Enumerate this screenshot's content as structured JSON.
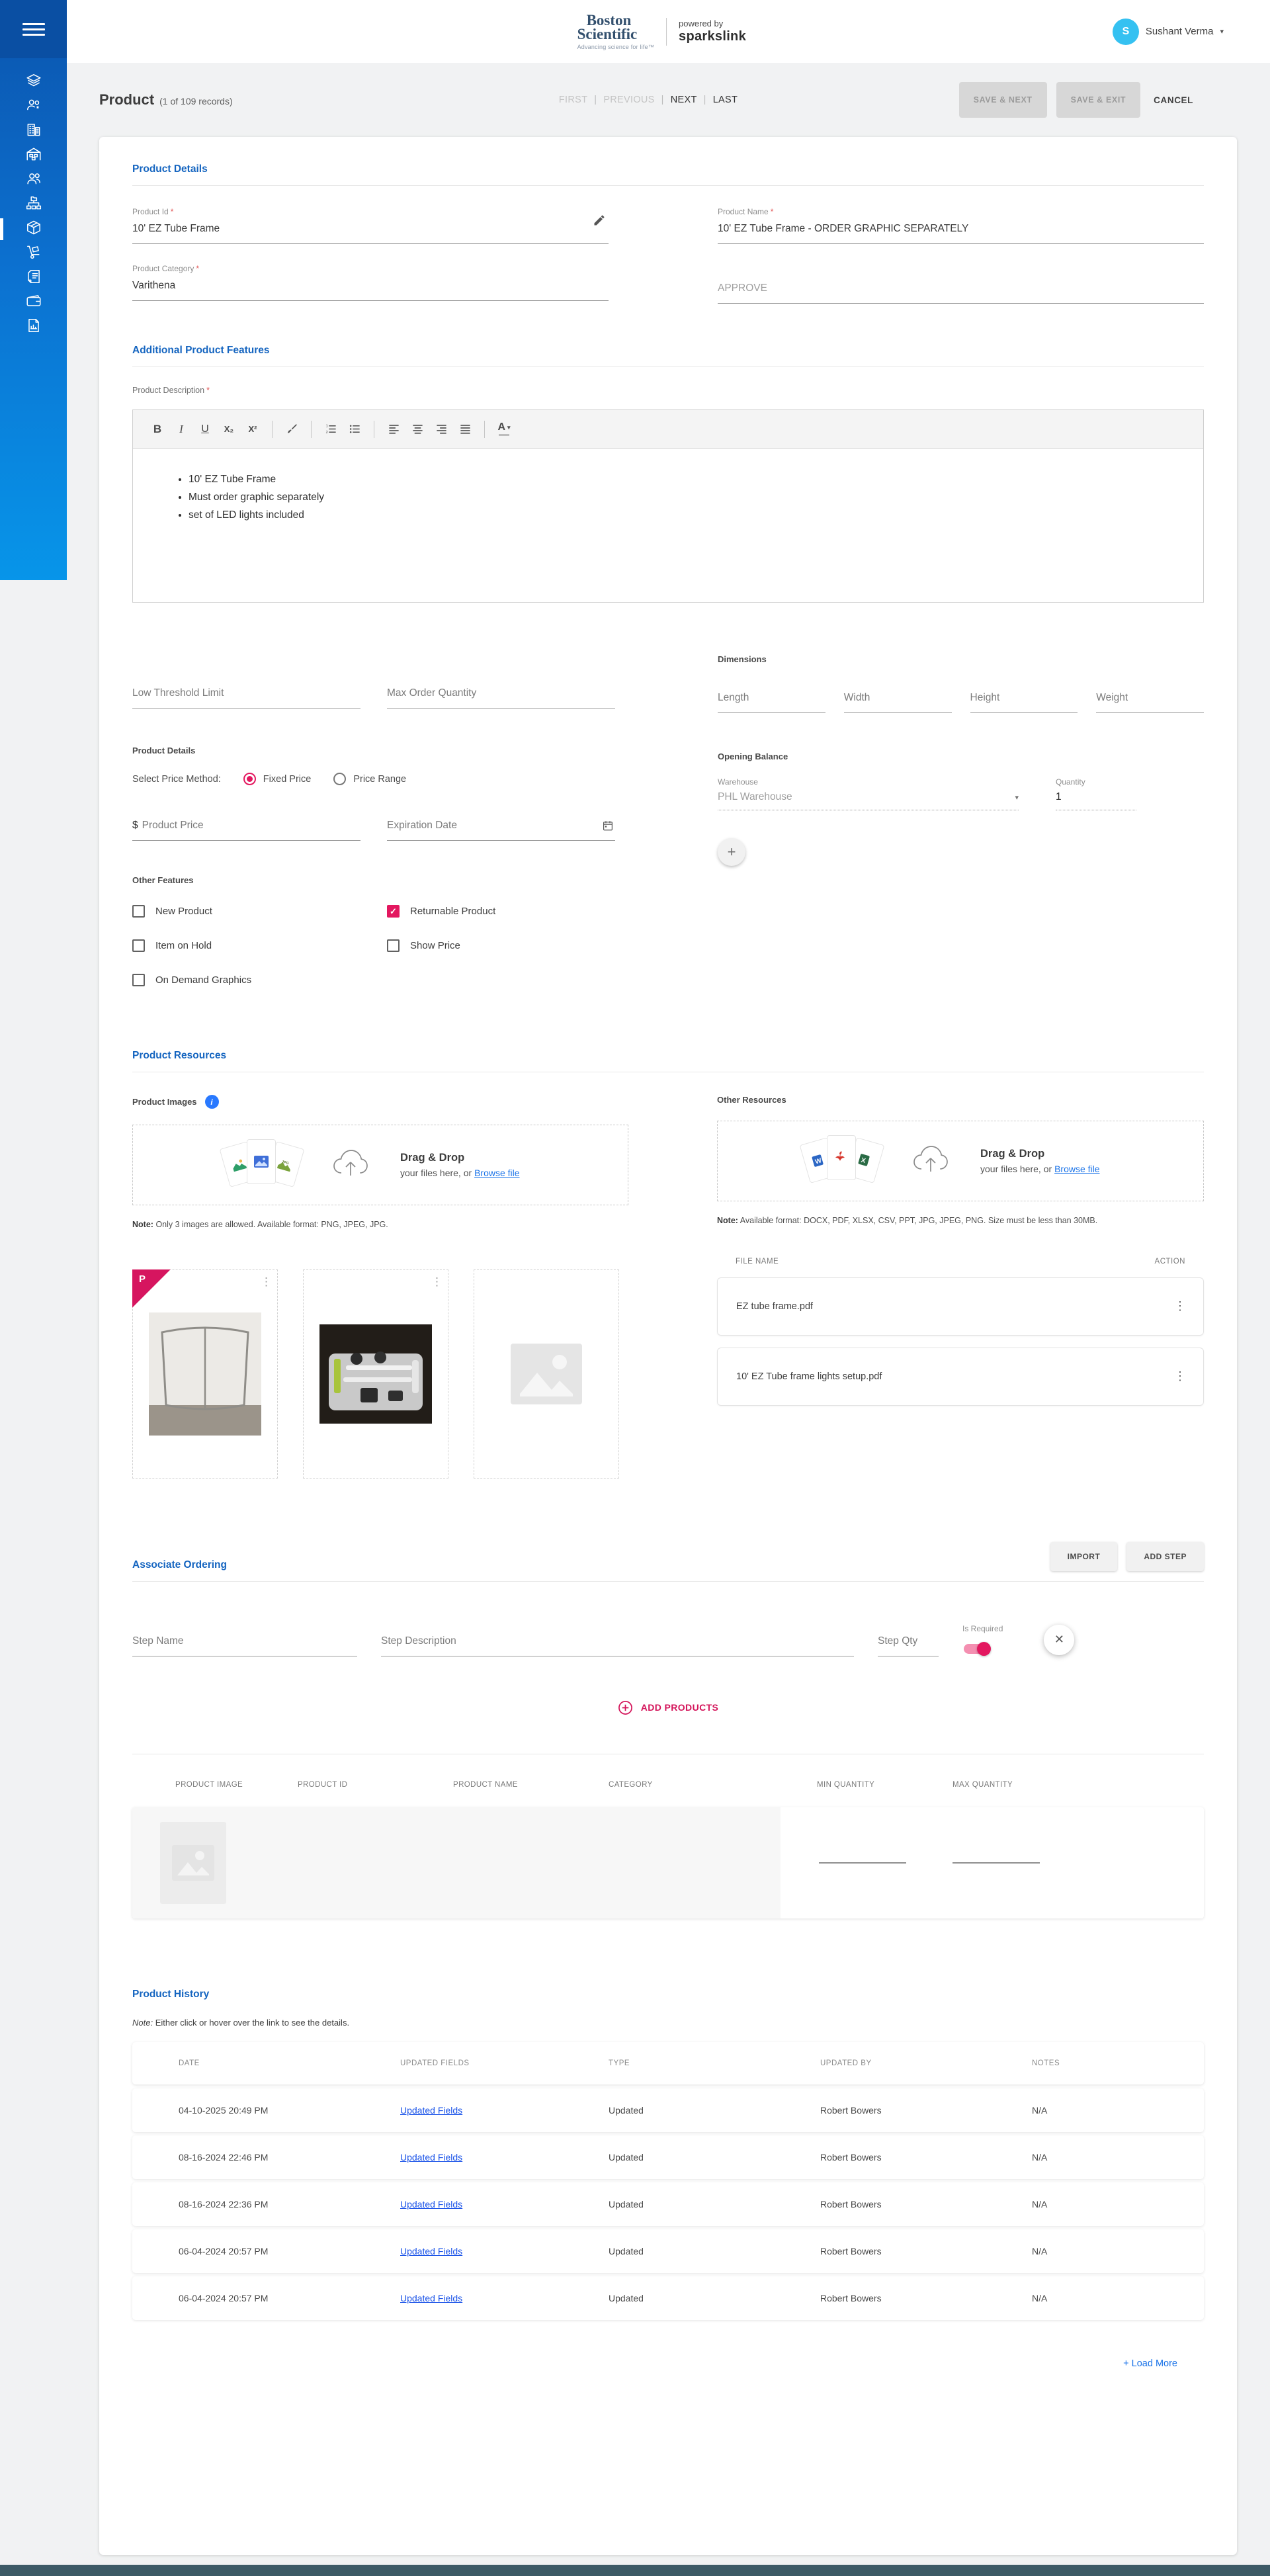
{
  "colors": {
    "accent_pink": "#e3175f",
    "primary_blue": "#1565c0",
    "link_blue": "#1a73e8",
    "sidebar_blue_top": "#0b55ae",
    "sidebar_blue_bottom": "#0795e9",
    "avatar_blue": "#35c1f1",
    "footer_slate": "#3d5a66"
  },
  "icons": {
    "check": "✓",
    "chevron_down": "▾",
    "kebab": "⋮",
    "plus": "+",
    "close": "✕",
    "info": "i",
    "dollar": "$"
  },
  "ui": {
    "required_mark": "*"
  },
  "sidebar": {
    "items": [
      {
        "icon": "layers",
        "active": false
      },
      {
        "icon": "user-roles",
        "active": false
      },
      {
        "icon": "organization",
        "active": false
      },
      {
        "icon": "warehouse",
        "active": false
      },
      {
        "icon": "users",
        "active": false
      },
      {
        "icon": "hierarchy",
        "active": false
      },
      {
        "icon": "products",
        "active": true
      },
      {
        "icon": "orders",
        "active": false
      },
      {
        "icon": "invoices",
        "active": false
      },
      {
        "icon": "wallet",
        "active": false
      },
      {
        "icon": "reports",
        "active": false
      }
    ]
  },
  "header": {
    "logo_line1": "Boston",
    "logo_line2": "Scientific",
    "logo_tagline": "Advancing science for life™",
    "powered_by": "powered by",
    "brand": "sparkslink",
    "user": {
      "initial": "S",
      "name": "Sushant Verma"
    }
  },
  "titlebar": {
    "title": "Product",
    "record_info": "(1 of 109 records)",
    "nav": [
      {
        "label": "FIRST",
        "enabled": false
      },
      {
        "label": "PREVIOUS",
        "enabled": false
      },
      {
        "label": "NEXT",
        "enabled": true
      },
      {
        "label": "LAST",
        "enabled": true
      }
    ],
    "save_next": "SAVE & NEXT",
    "save_exit": "SAVE & EXIT",
    "cancel": "CANCEL"
  },
  "product_details": {
    "heading": "Product Details",
    "product_id": {
      "label": "Product Id",
      "value": "10' EZ Tube Frame"
    },
    "product_name": {
      "label": "Product Name",
      "value": "10' EZ Tube Frame - ORDER GRAPHIC SEPARATELY"
    },
    "product_category": {
      "label": "Product Category",
      "value": "Varithena"
    },
    "approve": {
      "value": "APPROVE"
    }
  },
  "additional_features": {
    "heading": "Additional Product Features",
    "description_label": "Product Description",
    "toolbar": {
      "bold": "B",
      "italic": "I",
      "underline": "U",
      "subscript": "X₂",
      "superscript": "X²",
      "color": "A"
    },
    "bullets": [
      "10' EZ Tube Frame",
      "Must order graphic separately",
      "set of LED lights included"
    ]
  },
  "inventory": {
    "low_threshold_placeholder": "Low Threshold Limit",
    "max_order_placeholder": "Max Order Quantity",
    "details_heading": "Product Details",
    "price_method_label": "Select Price Method:",
    "price_options": [
      {
        "label": "Fixed Price",
        "selected": true
      },
      {
        "label": "Price Range",
        "selected": false
      }
    ],
    "price_prefix": "$",
    "price_placeholder": "Product Price",
    "expiration_placeholder": "Expiration Date",
    "dimensions_heading": "Dimensions",
    "dimension_fields": [
      "Length",
      "Width",
      "Height",
      "Weight"
    ],
    "opening_balance_heading": "Opening Balance",
    "warehouse_label": "Warehouse",
    "warehouse_value": "PHL Warehouse",
    "quantity_label": "Quantity",
    "quantity_value": "1",
    "other_features_heading": "Other Features",
    "checkboxes": [
      {
        "label": "New Product",
        "checked": false
      },
      {
        "label": "Returnable Product",
        "checked": true
      },
      {
        "label": "Item on Hold",
        "checked": false
      },
      {
        "label": "Show Price",
        "checked": false
      },
      {
        "label": "On Demand Graphics",
        "checked": false
      }
    ]
  },
  "resources": {
    "heading": "Product Resources",
    "dragdrop": {
      "title": "Drag & Drop",
      "subtitle": "your files here, or",
      "browse": "Browse file"
    },
    "images": {
      "label": "Product Images",
      "note_prefix": "Note:",
      "note": "Only 3 images are allowed. Available format: PNG, JPEG, JPG.",
      "primary_badge": "P"
    },
    "other": {
      "label": "Other Resources",
      "note_prefix": "Note:",
      "note": "Available format: DOCX, PDF, XLSX, CSV, PPT, JPG, JPEG, PNG. Size must be less than 30MB.",
      "table_headers": [
        "FILE NAME",
        "ACTION"
      ],
      "files": [
        {
          "name": "EZ tube frame.pdf"
        },
        {
          "name": "10' EZ Tube frame lights setup.pdf"
        }
      ]
    }
  },
  "associate_ordering": {
    "heading": "Associate Ordering",
    "import_btn": "IMPORT",
    "add_step_btn": "ADD STEP",
    "step_name_placeholder": "Step Name",
    "step_desc_placeholder": "Step Description",
    "step_qty_placeholder": "Step Qty",
    "is_required_label": "Is Required",
    "is_required_on": true,
    "add_products": "ADD PRODUCTS",
    "table_headers": [
      "PRODUCT IMAGE",
      "PRODUCT ID",
      "PRODUCT NAME",
      "CATEGORY",
      "MIN QUANTITY",
      "MAX QUANTITY"
    ]
  },
  "product_history": {
    "heading": "Product History",
    "note_prefix": "Note:",
    "note": " Either click or hover over the link to see the details.",
    "headers": [
      "DATE",
      "UPDATED FIELDS",
      "TYPE",
      "UPDATED BY",
      "NOTES"
    ],
    "rows": [
      {
        "date": "04-10-2025 20:49 PM",
        "link": "Updated Fields",
        "type": "Updated",
        "by": "Robert Bowers",
        "notes": "N/A"
      },
      {
        "date": "08-16-2024 22:46 PM",
        "link": "Updated Fields",
        "type": "Updated",
        "by": "Robert Bowers",
        "notes": "N/A"
      },
      {
        "date": "08-16-2024 22:36 PM",
        "link": "Updated Fields",
        "type": "Updated",
        "by": "Robert Bowers",
        "notes": "N/A"
      },
      {
        "date": "06-04-2024 20:57 PM",
        "link": "Updated Fields",
        "type": "Updated",
        "by": "Robert Bowers",
        "notes": "N/A"
      },
      {
        "date": "06-04-2024 20:57 PM",
        "link": "Updated Fields",
        "type": "Updated",
        "by": "Robert Bowers",
        "notes": "N/A"
      }
    ],
    "load_more": "+ Load More"
  }
}
